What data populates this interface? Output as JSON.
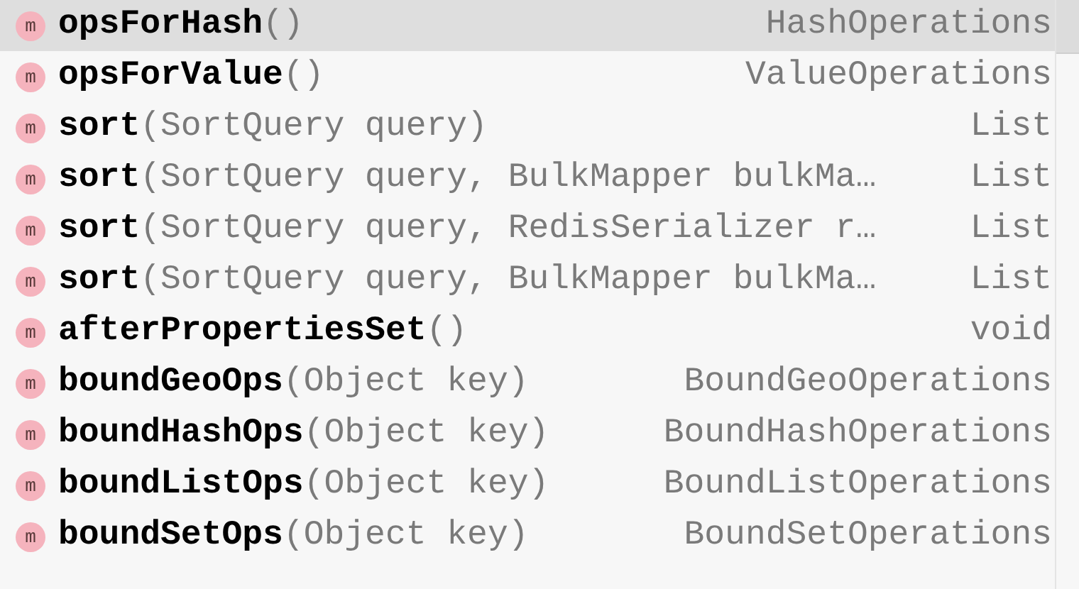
{
  "items": [
    {
      "icon": "m",
      "name": "opsForHash",
      "params": "()",
      "type": "HashOperations",
      "selected": true
    },
    {
      "icon": "m",
      "name": "opsForValue",
      "params": "()",
      "type": "ValueOperations",
      "selected": false
    },
    {
      "icon": "m",
      "name": "sort",
      "params": "(SortQuery query)",
      "type": "List",
      "selected": false
    },
    {
      "icon": "m",
      "name": "sort",
      "params": "(SortQuery query, BulkMapper bulkMa…",
      "type": "List",
      "selected": false
    },
    {
      "icon": "m",
      "name": "sort",
      "params": "(SortQuery query, RedisSerializer r…",
      "type": "List",
      "selected": false
    },
    {
      "icon": "m",
      "name": "sort",
      "params": "(SortQuery query, BulkMapper bulkMa…",
      "type": "List",
      "selected": false
    },
    {
      "icon": "m",
      "name": "afterPropertiesSet",
      "params": "()",
      "type": "void",
      "selected": false
    },
    {
      "icon": "m",
      "name": "boundGeoOps",
      "params": "(Object key)",
      "type": "BoundGeoOperations",
      "selected": false
    },
    {
      "icon": "m",
      "name": "boundHashOps",
      "params": "(Object key)",
      "type": "BoundHashOperations",
      "selected": false
    },
    {
      "icon": "m",
      "name": "boundListOps",
      "params": "(Object key)",
      "type": "BoundListOperations",
      "selected": false
    },
    {
      "icon": "m",
      "name": "boundSetOps",
      "params": "(Object key)",
      "type": "BoundSetOperations",
      "selected": false
    }
  ]
}
